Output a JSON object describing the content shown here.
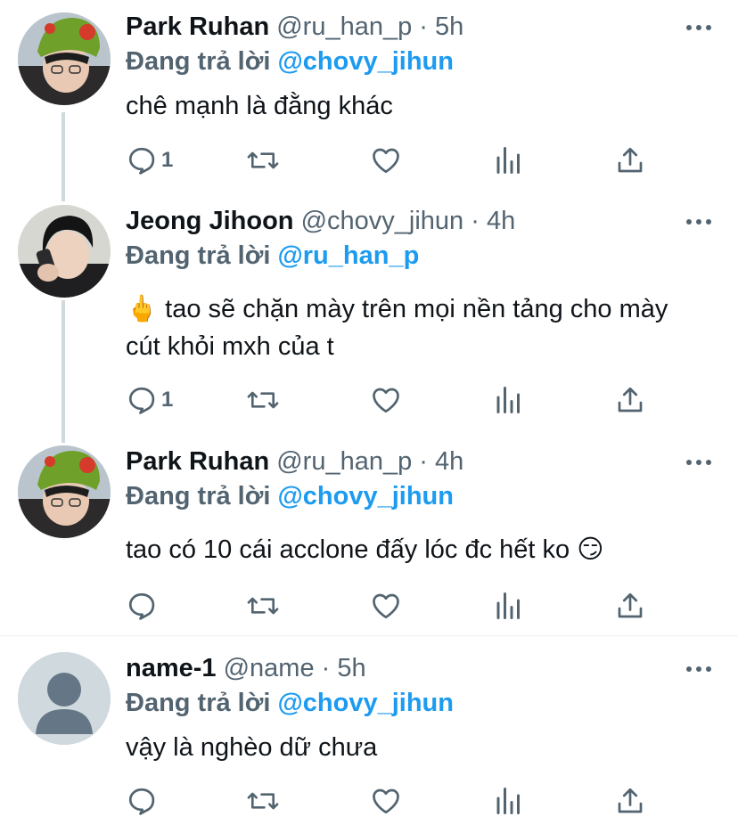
{
  "colors": {
    "link": "#1d9bf0",
    "muted": "#536471",
    "text": "#0f1419"
  },
  "tweets": [
    {
      "name": "Park Ruhan",
      "handle": "@ru_han_p",
      "separator": "·",
      "time": "5h",
      "reply_prefix": "Đang trả lời",
      "reply_to": "@chovy_jihun",
      "text": "chê mạnh là đằng khác",
      "reply_count": "1",
      "avatar": "photo-avatar-green-hat"
    },
    {
      "name": "Jeong Jihoon",
      "handle": "@chovy_jihun",
      "separator": "·",
      "time": "4h",
      "reply_prefix": "Đang trả lời",
      "reply_to": "@ru_han_p",
      "emoji": "🖕",
      "text": "tao sẽ chặn mày trên mọi nền tảng cho mày cút khỏi mxh của t",
      "reply_count": "1",
      "avatar": "photo-avatar-phone"
    },
    {
      "name": "Park Ruhan",
      "handle": "@ru_han_p",
      "separator": "·",
      "time": "4h",
      "reply_prefix": "Đang trả lời",
      "reply_to": "@chovy_jihun",
      "text": "tao có 10 cái acclone đấy lóc đc hết ko",
      "emoji": "😏",
      "reply_count": "",
      "avatar": "photo-avatar-green-hat"
    },
    {
      "name": "name-1",
      "handle": "@name",
      "separator": "·",
      "time": "5h",
      "reply_prefix": "Đang trả lời",
      "reply_to": "@chovy_jihun",
      "text": "vậy là nghèo dữ chưa",
      "reply_count": "",
      "avatar": "default-avatar"
    }
  ],
  "icons": [
    "reply-icon",
    "retweet-icon",
    "like-icon",
    "views-icon",
    "share-icon",
    "more-options-icon"
  ]
}
